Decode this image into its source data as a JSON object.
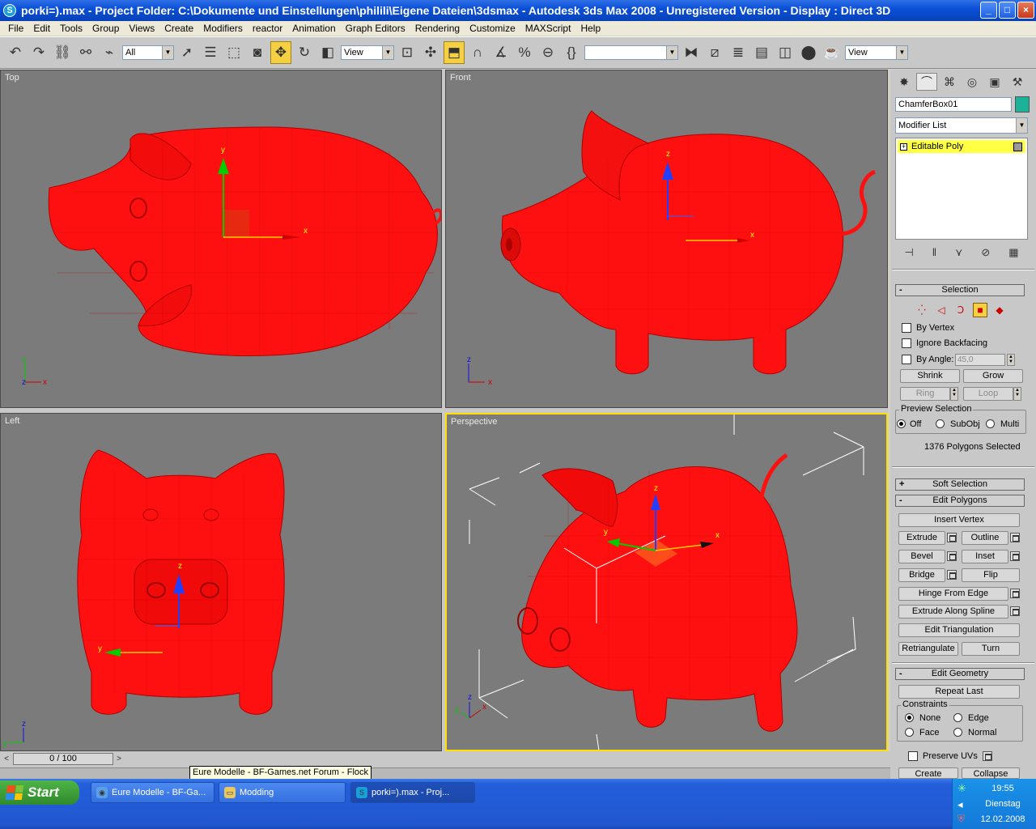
{
  "window": {
    "title": "porki=).max    - Project Folder: C:\\Dokumente und Einstellungen\\philili\\Eigene Dateien\\3dsmax     - Autodesk 3ds Max 2008    - Unregistered Version     - Display : Direct 3D",
    "min_glyph": "_",
    "max_glyph": "□",
    "close_glyph": "×"
  },
  "menu": [
    "File",
    "Edit",
    "Tools",
    "Group",
    "Views",
    "Create",
    "Modifiers",
    "reactor",
    "Animation",
    "Graph Editors",
    "Rendering",
    "Customize",
    "MAXScript",
    "Help"
  ],
  "toolbar": {
    "selection_filter": "All",
    "ref_coord": "View",
    "named_selection": "",
    "view_dropdown": "View"
  },
  "viewports": {
    "top": "Top",
    "front": "Front",
    "left": "Left",
    "perspective": "Perspective"
  },
  "axes": {
    "x": "x",
    "y": "y",
    "z": "z"
  },
  "panel": {
    "object_name": "ChamferBox01",
    "object_color": "#1ab39a",
    "modifier_list": "Modifier List",
    "stack_item": "Editable Poly",
    "selection": {
      "header": "Selection",
      "by_vertex": "By Vertex",
      "ignore_backfacing": "Ignore Backfacing",
      "by_angle": "By Angle:",
      "angle_value": "45,0",
      "shrink": "Shrink",
      "grow": "Grow",
      "ring": "Ring",
      "loop": "Loop",
      "preview_title": "Preview Selection",
      "off": "Off",
      "subobj": "SubObj",
      "multi": "Multi",
      "status": "1376 Polygons Selected"
    },
    "soft_selection": "Soft Selection",
    "edit_polygons": {
      "header": "Edit Polygons",
      "insert_vertex": "Insert Vertex",
      "extrude": "Extrude",
      "outline": "Outline",
      "bevel": "Bevel",
      "inset": "Inset",
      "bridge": "Bridge",
      "flip": "Flip",
      "hinge": "Hinge From Edge",
      "extrude_spline": "Extrude Along Spline",
      "edit_tri": "Edit Triangulation",
      "retriangulate": "Retriangulate",
      "turn": "Turn"
    },
    "edit_geometry": {
      "header": "Edit Geometry",
      "repeat_last": "Repeat Last",
      "constraints": "Constraints",
      "none": "None",
      "edge": "Edge",
      "face": "Face",
      "normal": "Normal",
      "preserve_uvs": "Preserve UVs",
      "create": "Create",
      "collapse": "Collapse"
    }
  },
  "timeline": {
    "frame": "0 / 100"
  },
  "tooltip": "Eure Modelle - BF-Games.net Forum - Flock",
  "taskbar": {
    "start": "Start",
    "tasks": [
      "Eure Modelle - BF-Ga...",
      "Modding",
      "porki=).max    - Proj..."
    ],
    "time": "19:55",
    "day": "Dienstag",
    "date": "12.02.2008"
  },
  "colors": {
    "pig": "#ff1010",
    "viewport_bg": "#7b7b7b",
    "active_border": "#ffe000"
  }
}
